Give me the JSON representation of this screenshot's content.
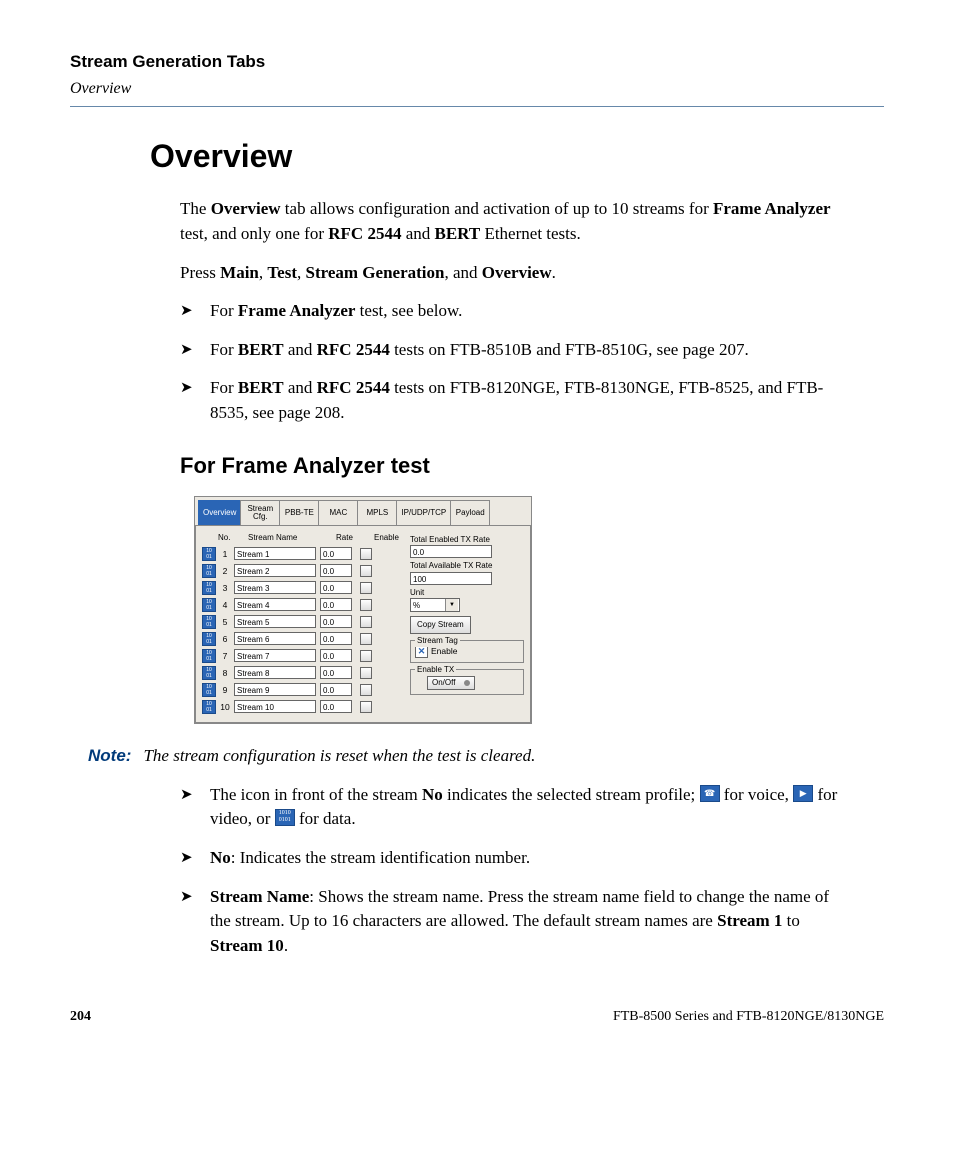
{
  "header": {
    "chapter": "Stream Generation Tabs",
    "section": "Overview"
  },
  "title": "Overview",
  "intro": {
    "t1": "The ",
    "b1": "Overview",
    "t2": " tab allows configuration and activation of up to 10 streams for ",
    "b2": "Frame Analyzer",
    "t3": " test, and only one for ",
    "b3": "RFC 2544",
    "t4": " and ",
    "b4": "BERT",
    "t5": " Ethernet tests."
  },
  "press": {
    "t1": "Press ",
    "b1": "Main",
    "c1": ", ",
    "b2": "Test",
    "c2": ", ",
    "b3": "Stream Generation",
    "c3": ", and ",
    "b4": "Overview",
    "t2": "."
  },
  "bullets_top": {
    "i1": {
      "t1": "For ",
      "b1": "Frame Analyzer",
      "t2": " test, see below."
    },
    "i2": {
      "t1": "For ",
      "b1": "BERT",
      "t2": " and ",
      "b2": "RFC 2544",
      "t3": " tests on FTB-8510B and FTB-8510G, see page 207."
    },
    "i3": {
      "t1": "For ",
      "b1": "BERT",
      "t2": " and ",
      "b2": "RFC 2544",
      "t3": " tests on FTB-8120NGE, FTB-8130NGE, FTB-8525, and FTB-8535, see page 208."
    }
  },
  "subtitle": "For Frame Analyzer test",
  "app": {
    "tabs": [
      "Overview",
      "Stream\nCfg.",
      "PBB-TE",
      "MAC",
      "MPLS",
      "IP/UDP/TCP",
      "Payload"
    ],
    "headers": {
      "no": "No.",
      "name": "Stream Name",
      "rate": "Rate",
      "enable": "Enable"
    },
    "streams": [
      {
        "no": "1",
        "name": "Stream 1",
        "rate": "0.0"
      },
      {
        "no": "2",
        "name": "Stream 2",
        "rate": "0.0"
      },
      {
        "no": "3",
        "name": "Stream 3",
        "rate": "0.0"
      },
      {
        "no": "4",
        "name": "Stream 4",
        "rate": "0.0"
      },
      {
        "no": "5",
        "name": "Stream 5",
        "rate": "0.0"
      },
      {
        "no": "6",
        "name": "Stream 6",
        "rate": "0.0"
      },
      {
        "no": "7",
        "name": "Stream 7",
        "rate": "0.0"
      },
      {
        "no": "8",
        "name": "Stream 8",
        "rate": "0.0"
      },
      {
        "no": "9",
        "name": "Stream 9",
        "rate": "0.0"
      },
      {
        "no": "10",
        "name": "Stream 10",
        "rate": "0.0"
      }
    ],
    "side": {
      "total_enabled_label": "Total Enabled TX Rate",
      "total_enabled_value": "0.0",
      "total_avail_label": "Total Available TX Rate",
      "total_avail_value": "100",
      "unit_label": "Unit",
      "unit_value": "%",
      "copy_button": "Copy Stream",
      "stream_tag_label": "Stream Tag",
      "stream_tag_enable": "Enable",
      "enable_tx_label": "Enable TX",
      "onoff_label": "On/Off"
    }
  },
  "note": {
    "label": "Note:",
    "text": "The stream configuration is reset when the test is cleared."
  },
  "bullets_bottom": {
    "i1": {
      "t1": "The icon in front of the stream ",
      "b1": "No",
      "t2": " indicates the selected stream profile; ",
      "voice": " for voice, ",
      "video": " for video, or ",
      "data": " for data."
    },
    "i2": {
      "b1": "No",
      "t1": ": Indicates the stream identification number."
    },
    "i3": {
      "b1": "Stream Name",
      "t1": ": Shows the stream name. Press the stream name field to change the name of the stream. Up to 16 characters are allowed. The default stream names are ",
      "b2": "Stream 1",
      "t2": " to ",
      "b3": "Stream 10",
      "t3": "."
    }
  },
  "footer": {
    "page": "204",
    "doc": "FTB-8500 Series and FTB-8120NGE/8130NGE"
  }
}
